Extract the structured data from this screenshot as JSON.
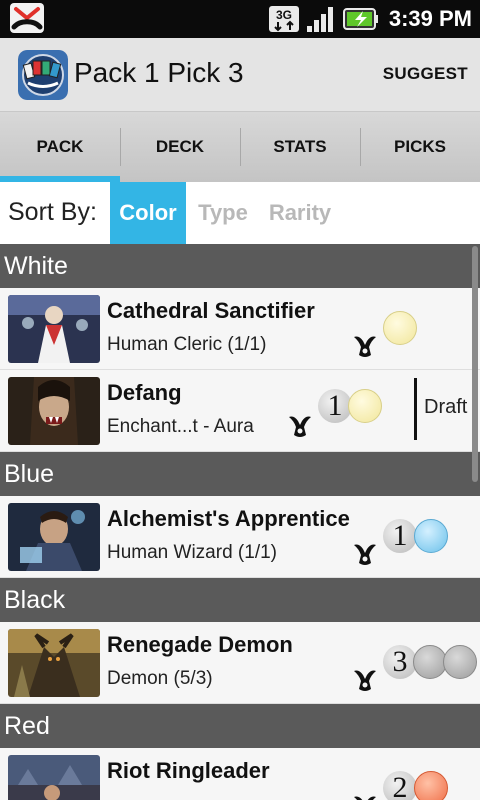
{
  "status_bar": {
    "time": "3:39 PM",
    "network": "3G",
    "icons": [
      "missed-call-icon",
      "3g-data-icon",
      "signal-icon",
      "battery-charging-icon"
    ]
  },
  "header": {
    "title": "Pack 1 Pick 3",
    "suggest_label": "SUGGEST",
    "icon": "app-logo-icon"
  },
  "tabs": [
    {
      "label": "PACK",
      "active": true
    },
    {
      "label": "DECK"
    },
    {
      "label": "STATS"
    },
    {
      "label": "PICKS"
    }
  ],
  "sort": {
    "label": "Sort By:",
    "options": [
      {
        "label": "Color",
        "selected": true
      },
      {
        "label": "Type"
      },
      {
        "label": "Rarity"
      }
    ]
  },
  "accent_color": "#33b5e5",
  "sections": [
    {
      "name": "White"
    },
    {
      "name": "Blue"
    },
    {
      "name": "Black"
    },
    {
      "name": "Red"
    }
  ],
  "cards": [
    {
      "name": "Cathedral Sanctifier",
      "type": "Human Cleric (1/1)",
      "cost": [
        "W"
      ]
    },
    {
      "name": "Defang",
      "type": "Enchant...t  - Aura",
      "cost": [
        "1",
        "W"
      ],
      "extra": "Draft"
    },
    {
      "name": "Alchemist's Apprentice",
      "type": "Human Wizard (1/1)",
      "cost": [
        "1",
        "U"
      ]
    },
    {
      "name": "Renegade Demon",
      "type": "Demon (5/3)",
      "cost": [
        "3",
        "B",
        "B"
      ]
    },
    {
      "name": "Riot Ringleader",
      "type": "",
      "cost": [
        "2",
        "R"
      ]
    }
  ]
}
